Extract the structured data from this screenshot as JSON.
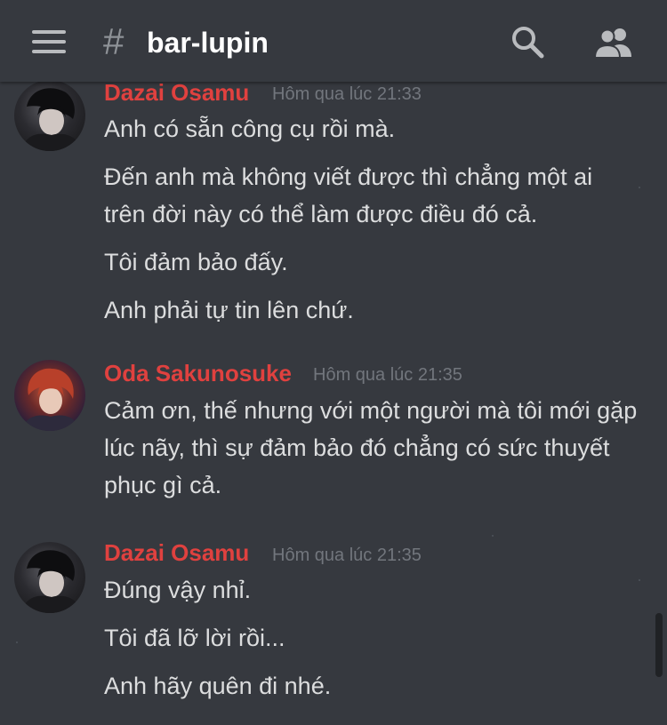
{
  "header": {
    "hash": "#",
    "channel_name": "bar-lupin",
    "menu_icon": "hamburger-icon",
    "search_icon": "search-icon",
    "members_icon": "members-icon"
  },
  "colors": {
    "background": "#36393f",
    "username": "#e0413f",
    "timestamp": "#72767d",
    "text": "#dcddde"
  },
  "messages": [
    {
      "author": "Dazai Osamu",
      "timestamp": "Hôm qua lúc 21:33",
      "lines": [
        "Anh có sẵn công cụ rồi mà.",
        "Đến anh mà không viết được thì chẳng một ai trên đời này có thể làm được điều đó cả.",
        "Tôi đảm bảo đấy.",
        "Anh phải tự tin lên chứ."
      ]
    },
    {
      "author": "Oda Sakunosuke",
      "timestamp": "Hôm qua lúc 21:35",
      "lines": [
        "Cảm ơn, thế nhưng với một người mà tôi mới gặp lúc nãy, thì sự đảm bảo đó chẳng có sức thuyết phục gì cả."
      ]
    },
    {
      "author": "Dazai Osamu",
      "timestamp": "Hôm qua lúc 21:35",
      "lines": [
        "Đúng vậy nhỉ.",
        "Tôi đã lỡ lời rồi...",
        "Anh hãy quên đi nhé."
      ]
    }
  ]
}
